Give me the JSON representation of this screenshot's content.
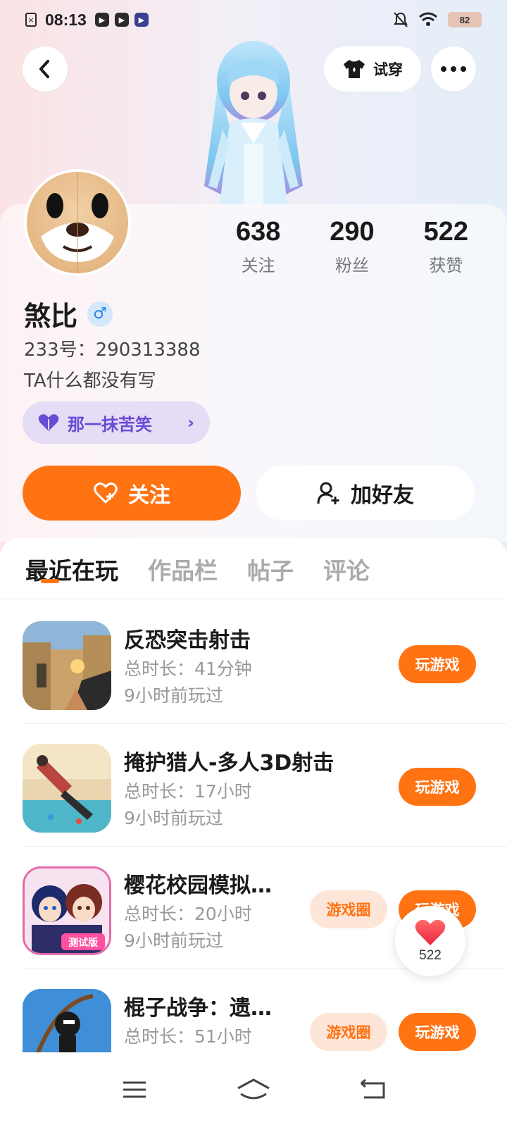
{
  "status_bar": {
    "time": "08:13",
    "battery": "82"
  },
  "header": {
    "tryon_label": "试穿"
  },
  "profile": {
    "username": "煞比",
    "gender_symbol": "♂",
    "account_id": "233号：290313388",
    "bio": "TA什么都没有写",
    "tag": "那一抹苦笑",
    "stats": [
      {
        "value": "638",
        "label": "关注"
      },
      {
        "value": "290",
        "label": "粉丝"
      },
      {
        "value": "522",
        "label": "获赞"
      }
    ]
  },
  "actions": {
    "follow_label": "关注",
    "add_friend_label": "加好友"
  },
  "tabs": [
    "最近在玩",
    "作品栏",
    "帖子",
    "评论"
  ],
  "games": [
    {
      "title": "反恐突击射击",
      "duration": "总时长：41分钟",
      "last_played": "9小时前玩过",
      "play_label": "玩游戏",
      "circle_label": ""
    },
    {
      "title": "掩护猎人-多人3D射击",
      "duration": "总时长：17小时",
      "last_played": "9小时前玩过",
      "play_label": "玩游戏",
      "circle_label": ""
    },
    {
      "title": "樱花校园模拟…",
      "duration": "总时长：20小时",
      "last_played": "9小时前玩过",
      "play_label": "玩游戏",
      "circle_label": "游戏圈",
      "icon_badge": "测试版"
    },
    {
      "title": "棍子战争：遗…",
      "duration": "总时长：51小时",
      "last_played": "",
      "play_label": "玩游戏",
      "circle_label": "游戏圈"
    }
  ],
  "float_like": {
    "count": "522"
  },
  "colors": {
    "accent": "#ff7313",
    "tag_purple": "#6a4bd4",
    "gender_blue": "#2a82e8"
  }
}
